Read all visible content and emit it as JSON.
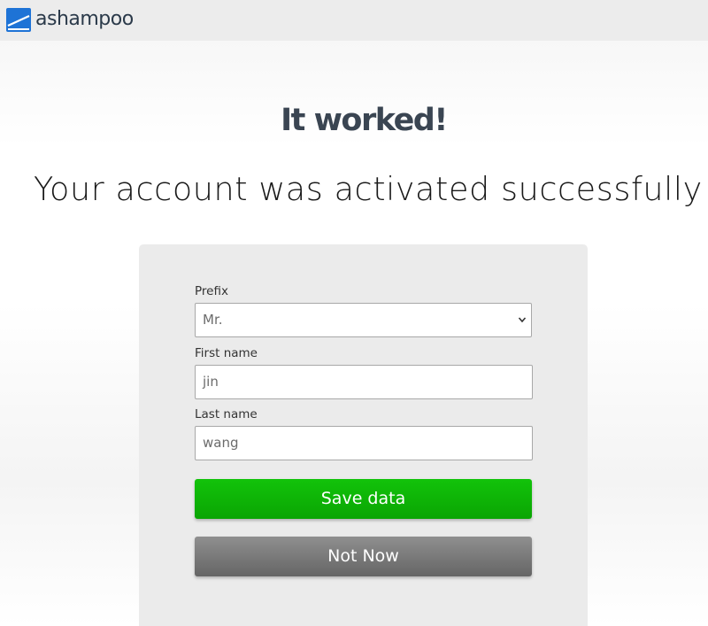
{
  "header": {
    "logo_text": "ashampoo",
    "logo_color": "#1e73d6"
  },
  "main": {
    "title": "It worked!",
    "subtitle": "Your account was activated successfully!"
  },
  "form": {
    "prefix": {
      "label": "Prefix",
      "value": "Mr."
    },
    "first_name": {
      "label": "First name",
      "value": "jin"
    },
    "last_name": {
      "label": "Last name",
      "value": "wang"
    },
    "save_label": "Save data",
    "not_now_label": "Not Now",
    "save_color": "#0bb504",
    "not_now_color": "#7a7a7a"
  }
}
